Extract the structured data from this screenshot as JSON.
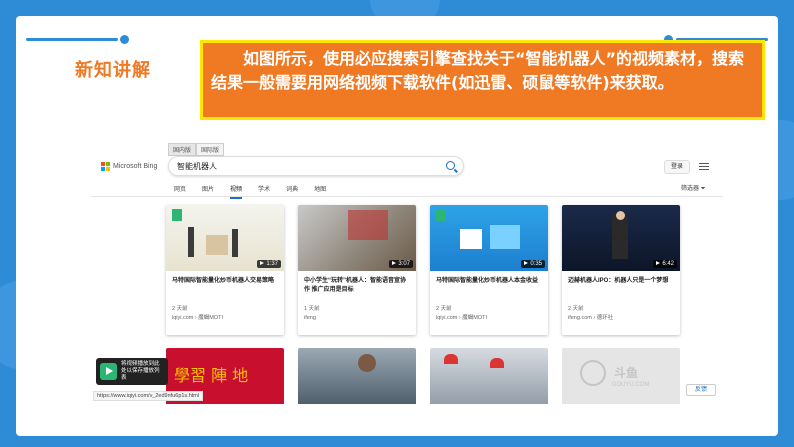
{
  "slide": {
    "section_title": "新知讲解",
    "callout_text": "　　如图所示，使用必应搜索引擎查找关于“智能机器人”的视频素材，搜索结果一般需要用网络视频下载软件(如迅雷、硕鼠等软件)来获取。"
  },
  "browser": {
    "locale_tabs": [
      "国内版",
      "国际版"
    ],
    "logo_text": "Microsoft Bing",
    "search_query": "智能机器人",
    "login_label": "登录",
    "nav_tabs": [
      "网页",
      "图片",
      "视频",
      "学术",
      "词典",
      "地图"
    ],
    "active_tab": "视频",
    "filter_label": "筛选器",
    "videos": [
      {
        "title": "马特国际智能量化炒币机器人交易策略",
        "duration": "1:37",
        "age": "2 天前",
        "source": "lqiyi.com › 魔蝎MOTI"
      },
      {
        "title": "中小学生“玩转”机器人：智能语音宣协作 推广应用是目标",
        "duration": "3:07",
        "age": "1 天前",
        "source": "ifeng"
      },
      {
        "title": "马特国际智能量化炒币机器人本金收益",
        "duration": "0:35",
        "age": "2 天前",
        "source": "lqiyi.com › 魔蝎MOTI"
      },
      {
        "title": "迈赫机器人IPO：机器人只是一个梦想",
        "duration": "6:42",
        "age": "2 天前",
        "source": "ifeng.com › 德环社"
      }
    ],
    "row2_texts": [
      "學習 陣 地",
      "DOUYU.COM"
    ],
    "feedback_label": "反馈",
    "status_url": "https://www.iqiyi.com/v_2ed9nfu6p1s.html",
    "popup_text": "将视频播放到此处以保存播放列表"
  },
  "colors": {
    "accent": "#f07a24",
    "callout_border": "#ffe600",
    "frame": "#2e8bd6",
    "link": "#1a6fc9"
  }
}
